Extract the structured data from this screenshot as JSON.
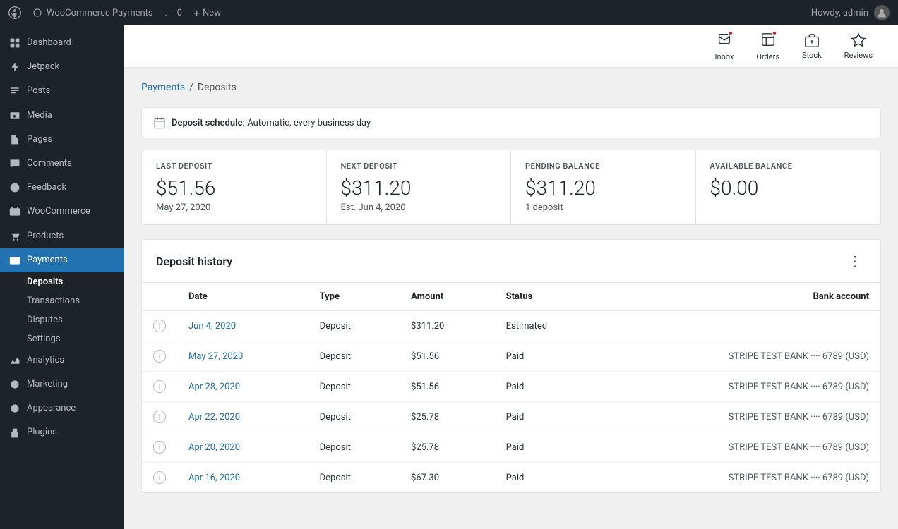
{
  "adminbar": {
    "logo_label": "WordPress",
    "site_name": "WooCommerce Payments",
    "comments_label": "0",
    "new_label": "New",
    "howdy_label": "Howdy, admin"
  },
  "sidebar": {
    "items": [
      {
        "id": "dashboard",
        "label": "Dashboard",
        "icon": "dashboard"
      },
      {
        "id": "jetpack",
        "label": "Jetpack",
        "icon": "jetpack"
      },
      {
        "id": "posts",
        "label": "Posts",
        "icon": "posts"
      },
      {
        "id": "media",
        "label": "Media",
        "icon": "media"
      },
      {
        "id": "pages",
        "label": "Pages",
        "icon": "pages"
      },
      {
        "id": "comments",
        "label": "Comments",
        "icon": "comments"
      },
      {
        "id": "feedback",
        "label": "Feedback",
        "icon": "feedback"
      },
      {
        "id": "woocommerce",
        "label": "WooCommerce",
        "icon": "woocommerce"
      },
      {
        "id": "products",
        "label": "Products",
        "icon": "products"
      },
      {
        "id": "payments",
        "label": "Payments",
        "icon": "payments",
        "active": true
      }
    ],
    "sub_items": [
      {
        "id": "deposits",
        "label": "Deposits",
        "active": true
      },
      {
        "id": "transactions",
        "label": "Transactions"
      },
      {
        "id": "disputes",
        "label": "Disputes"
      },
      {
        "id": "settings",
        "label": "Settings"
      }
    ],
    "bottom_items": [
      {
        "id": "analytics",
        "label": "Analytics",
        "icon": "analytics"
      },
      {
        "id": "marketing",
        "label": "Marketing",
        "icon": "marketing"
      },
      {
        "id": "appearance",
        "label": "Appearance",
        "icon": "appearance"
      },
      {
        "id": "plugins",
        "label": "Plugins",
        "icon": "plugins"
      }
    ]
  },
  "header_actions": [
    {
      "id": "inbox",
      "label": "Inbox",
      "badge": true
    },
    {
      "id": "orders",
      "label": "Orders",
      "badge": true
    },
    {
      "id": "stock",
      "label": "Stock",
      "badge": false
    },
    {
      "id": "reviews",
      "label": "Reviews",
      "badge": false
    }
  ],
  "breadcrumb": {
    "parent": "Payments",
    "separator": "/",
    "current": "Deposits"
  },
  "deposit_schedule": {
    "label": "Deposit schedule:",
    "value": "Automatic, every business day"
  },
  "stats": [
    {
      "id": "last_deposit",
      "label": "LAST DEPOSIT",
      "value": "$51.56",
      "sub": "May 27, 2020"
    },
    {
      "id": "next_deposit",
      "label": "NEXT DEPOSIT",
      "value": "$311.20",
      "sub": "Est. Jun 4, 2020"
    },
    {
      "id": "pending_balance",
      "label": "PENDING BALANCE",
      "value": "$311.20",
      "sub": "1 deposit"
    },
    {
      "id": "available_balance",
      "label": "AVAILABLE BALANCE",
      "value": "$0.00",
      "sub": ""
    }
  ],
  "deposit_history": {
    "title": "Deposit history",
    "columns": [
      "Date",
      "Type",
      "Amount",
      "Status",
      "Bank account"
    ],
    "rows": [
      {
        "date": "Jun 4, 2020",
        "type": "Deposit",
        "amount": "$311.20",
        "status": "Estimated",
        "bank": ""
      },
      {
        "date": "May 27, 2020",
        "type": "Deposit",
        "amount": "$51.56",
        "status": "Paid",
        "bank": "STRIPE TEST BANK ···· 6789 (USD)"
      },
      {
        "date": "Apr 28, 2020",
        "type": "Deposit",
        "amount": "$51.56",
        "status": "Paid",
        "bank": "STRIPE TEST BANK ···· 6789 (USD)"
      },
      {
        "date": "Apr 22, 2020",
        "type": "Deposit",
        "amount": "$25.78",
        "status": "Paid",
        "bank": "STRIPE TEST BANK ···· 6789 (USD)"
      },
      {
        "date": "Apr 20, 2020",
        "type": "Deposit",
        "amount": "$25.78",
        "status": "Paid",
        "bank": "STRIPE TEST BANK ···· 6789 (USD)"
      },
      {
        "date": "Apr 16, 2020",
        "type": "Deposit",
        "amount": "$67.30",
        "status": "Paid",
        "bank": "STRIPE TEST BANK ···· 6789 (USD)"
      }
    ]
  }
}
